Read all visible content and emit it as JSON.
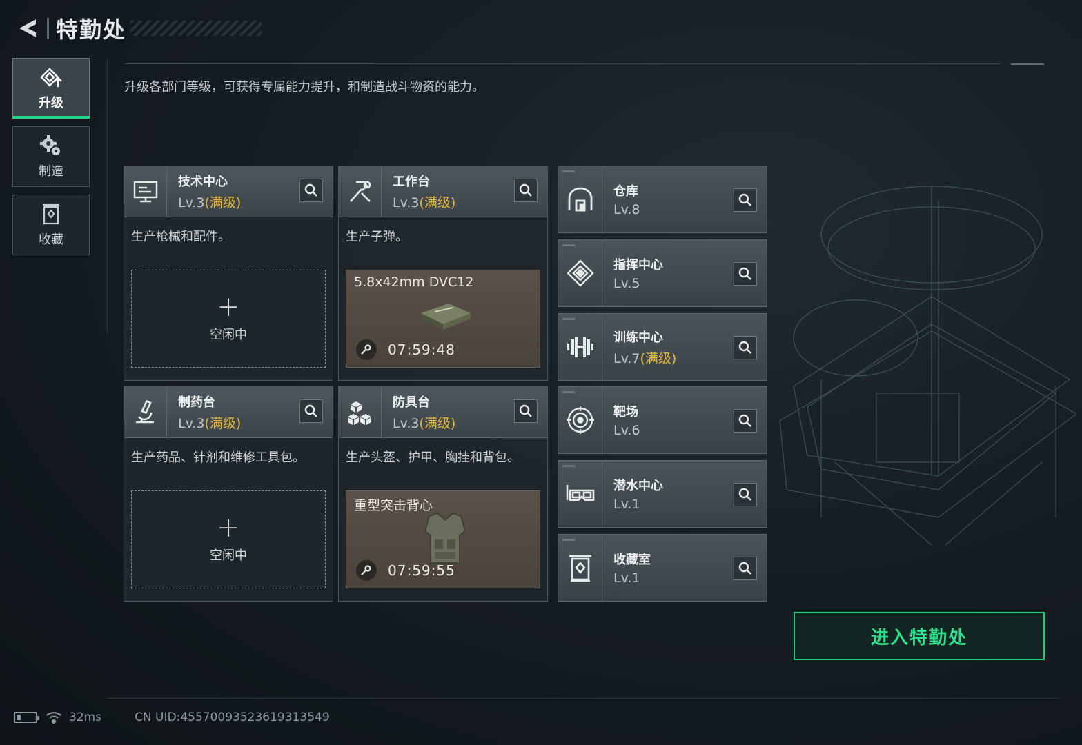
{
  "header": {
    "title": "特勤处"
  },
  "sidenav": {
    "items": [
      {
        "label": "升级",
        "icon": "upgrade-icon",
        "active": true
      },
      {
        "label": "制造",
        "icon": "gears-icon",
        "active": false
      },
      {
        "label": "收藏",
        "icon": "collection-icon",
        "active": false
      }
    ]
  },
  "description": "升级各部门等级，可获得专属能力提升，和制造战斗物资的能力。",
  "cards": [
    {
      "name": "技术中心",
      "level": "Lv.3",
      "max": "(满级)",
      "icon": "computer-icon",
      "desc": "生产枪械和配件。",
      "slot": {
        "state": "empty",
        "plus": "+",
        "label": "空闲中"
      }
    },
    {
      "name": "工作台",
      "level": "Lv.3",
      "max": "(满级)",
      "icon": "hammer-icon",
      "desc": "生产子弹。",
      "slot": {
        "state": "producing",
        "item": "5.8x42mm DVC12",
        "timer": "07:59:48"
      }
    },
    {
      "name": "制药台",
      "level": "Lv.3",
      "max": "(满级)",
      "icon": "microscope-icon",
      "desc": "生产药品、针剂和维修工具包。",
      "slot": {
        "state": "empty",
        "plus": "+",
        "label": "空闲中"
      }
    },
    {
      "name": "防具台",
      "level": "Lv.3",
      "max": "(满级)",
      "icon": "blocks-icon",
      "desc": "生产头盔、护甲、胸挂和背包。",
      "slot": {
        "state": "producing",
        "item": "重型突击背心",
        "timer": "07:59:55"
      }
    }
  ],
  "side_cards": [
    {
      "name": "仓库",
      "level": "Lv.8",
      "max": "",
      "icon": "warehouse-icon"
    },
    {
      "name": "指挥中心",
      "level": "Lv.5",
      "max": "",
      "icon": "command-icon"
    },
    {
      "name": "训练中心",
      "level": "Lv.7",
      "max": "(满级)",
      "icon": "dumbbell-icon"
    },
    {
      "name": "靶场",
      "level": "Lv.6",
      "max": "",
      "icon": "target-icon"
    },
    {
      "name": "潜水中心",
      "level": "Lv.1",
      "max": "",
      "icon": "diving-mask-icon"
    },
    {
      "name": "收藏室",
      "level": "Lv.1",
      "max": "",
      "icon": "collection-room-icon"
    }
  ],
  "enter_button": "进入特勤处",
  "footer": {
    "ping": "32ms",
    "uid": "CN UID:455700935236193135​49"
  },
  "colors": {
    "accent": "#21d487",
    "max_level": "#e6b93c"
  }
}
